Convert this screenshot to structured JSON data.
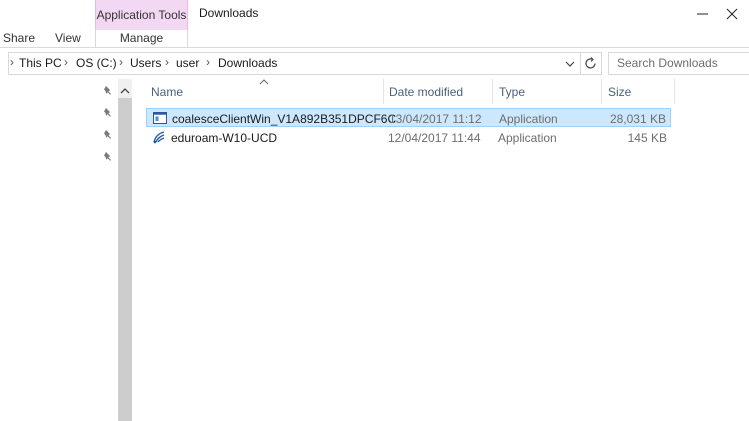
{
  "window": {
    "title": "Downloads",
    "context_tab_group": "Application Tools",
    "context_tab": "Manage",
    "ribbon_tabs": [
      "Share",
      "View"
    ]
  },
  "address": {
    "breadcrumbs": [
      "This PC",
      "OS (C:)",
      "Users",
      "user",
      "Downloads"
    ],
    "search_placeholder": "Search Downloads"
  },
  "columns": {
    "name": "Name",
    "date": "Date modified",
    "type": "Type",
    "size": "Size"
  },
  "files": [
    {
      "name": "coalesceClientWin_V1A892B351DPCF6C",
      "date": "13/04/2017 11:12",
      "type": "Application",
      "size": "28,031 KB",
      "selected": true,
      "icon": "application-window-icon"
    },
    {
      "name": "eduroam-W10-UCD",
      "date": "12/04/2017 11:44",
      "type": "Application",
      "size": "145 KB",
      "selected": false,
      "icon": "eduroam-app-icon"
    }
  ],
  "colors": {
    "selection": "#cce8ff",
    "selection_border": "#99d1ff",
    "context_tab": "#f3d8f3",
    "header_text": "#4c607a"
  }
}
